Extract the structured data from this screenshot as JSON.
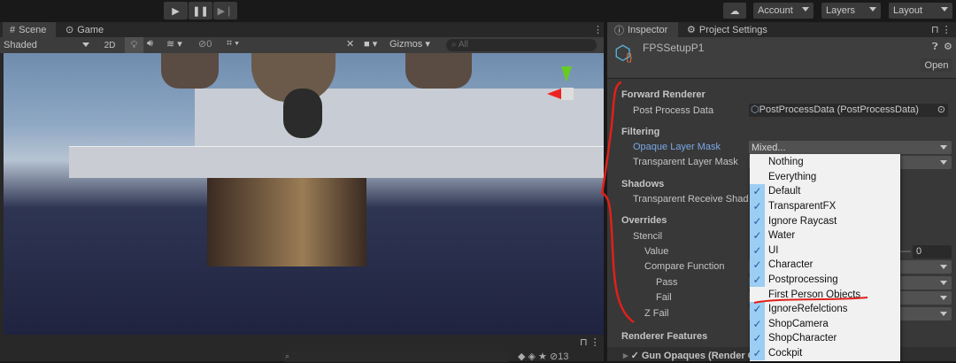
{
  "toolbar": {
    "play_icon": "play-icon",
    "pause_icon": "pause-icon",
    "step_icon": "step-icon",
    "account": "Account",
    "layers": "Layers",
    "layout": "Layout"
  },
  "scene": {
    "tabs": [
      {
        "label": "Scene",
        "icon": "grid-icon"
      },
      {
        "label": "Game",
        "icon": "gamepad-icon"
      }
    ],
    "shading": "Shaded",
    "mode_2d": "2D",
    "hidden_count": "0",
    "gizmos": "Gizmos",
    "search_placeholder": "All"
  },
  "project": {
    "hidden_count": "13"
  },
  "inspector": {
    "tabs": [
      {
        "label": "Inspector"
      },
      {
        "label": "Project Settings"
      }
    ],
    "asset_name": "FPSSetupP1",
    "open_label": "Open",
    "rows": {
      "forward_renderer": "Forward Renderer",
      "post_process_data": "Post Process Data",
      "post_process_value": "PostProcessData (PostProcessData)",
      "filtering": "Filtering",
      "opaque_mask": "Opaque Layer Mask",
      "opaque_value": "Mixed...",
      "transparent_mask": "Transparent Layer Mask",
      "shadows": "Shadows",
      "transparent_receive": "Transparent Receive Shad",
      "overrides": "Overrides",
      "stencil": "Stencil",
      "value": "Value",
      "value_number": "0",
      "compare_function": "Compare Function",
      "pass": "Pass",
      "fail": "Fail",
      "z_fail": "Z Fail",
      "renderer_features": "Renderer Features",
      "gun_opaques": "Gun Opaques (Render O"
    }
  },
  "layer_menu": [
    {
      "label": "Nothing",
      "checked": false
    },
    {
      "label": "Everything",
      "checked": false
    },
    {
      "label": "Default",
      "checked": true
    },
    {
      "label": "TransparentFX",
      "checked": true
    },
    {
      "label": "Ignore Raycast",
      "checked": true
    },
    {
      "label": "Water",
      "checked": true
    },
    {
      "label": "UI",
      "checked": true
    },
    {
      "label": "Character",
      "checked": true
    },
    {
      "label": "Postprocessing",
      "checked": true
    },
    {
      "label": "First Person Objects",
      "checked": false
    },
    {
      "label": "IgnoreRefelctions",
      "checked": true
    },
    {
      "label": "ShopCamera",
      "checked": true
    },
    {
      "label": "ShopCharacter",
      "checked": true
    },
    {
      "label": "Cockpit",
      "checked": true
    }
  ],
  "colors": {
    "accent_blue": "#9ccdf3",
    "annotation_red": "#e0201a",
    "label_highlight": "#7ba7e6"
  }
}
